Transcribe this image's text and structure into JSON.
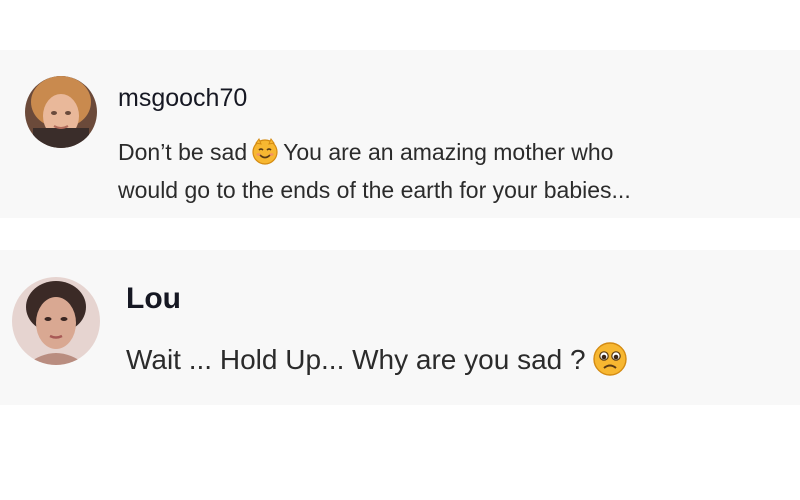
{
  "comments": [
    {
      "username": "msgooch70",
      "text_part1": "Don’t be sad",
      "emoji": "smiling-face-icon",
      "text_part2": "You are an amazing mother who",
      "text_line2": "would go to the ends of the earth for your babies..."
    },
    {
      "username": "Lou",
      "text_part1": "Wait ... Hold Up... Why are you sad ?",
      "emoji": "worried-face-icon"
    }
  ],
  "colors": {
    "comment_background": "#f8f8f8",
    "username": "#161823",
    "text": "#2b2b2b",
    "emoji_yellow": "#f7b731"
  }
}
